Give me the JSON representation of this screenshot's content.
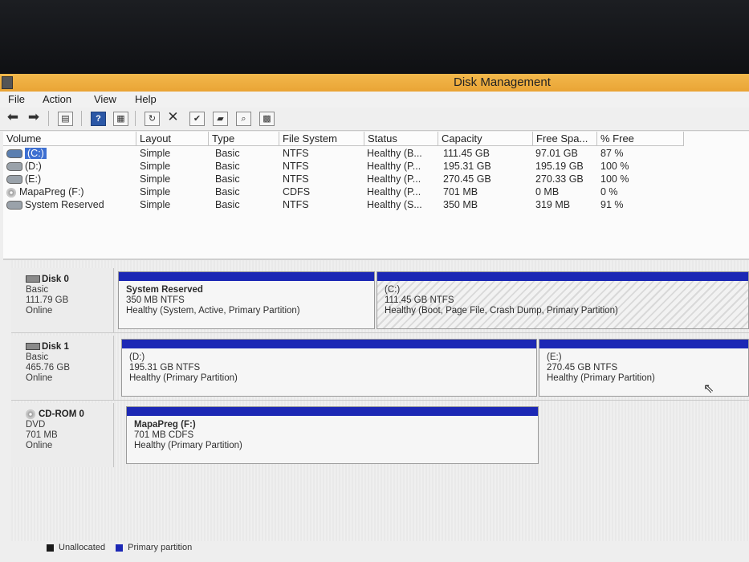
{
  "window": {
    "title": "Disk Management"
  },
  "menu": [
    "File",
    "Action",
    "View",
    "Help"
  ],
  "toolbar": {
    "buttons": [
      "back-arrow-icon",
      "forward-arrow-icon",
      "console-tree-icon",
      "help-icon",
      "properties-icon",
      "refresh-icon",
      "delete-icon",
      "check-icon",
      "open-icon",
      "search-icon",
      "explore-icon"
    ]
  },
  "volume_table": {
    "columns": [
      "Volume",
      "Layout",
      "Type",
      "File System",
      "Status",
      "Capacity",
      "Free Spa...",
      "% Free"
    ],
    "rows": [
      {
        "volume": "(C:)",
        "layout": "Simple",
        "type": "Basic",
        "fs": "NTFS",
        "status": "Healthy (B...",
        "capacity": "111.45 GB",
        "free": "97.01 GB",
        "pct": "87 %"
      },
      {
        "volume": "(D:)",
        "layout": "Simple",
        "type": "Basic",
        "fs": "NTFS",
        "status": "Healthy (P...",
        "capacity": "195.31 GB",
        "free": "195.19 GB",
        "pct": "100 %"
      },
      {
        "volume": "(E:)",
        "layout": "Simple",
        "type": "Basic",
        "fs": "NTFS",
        "status": "Healthy (P...",
        "capacity": "270.45 GB",
        "free": "270.33 GB",
        "pct": "100 %"
      },
      {
        "volume": "MapaPreg (F:)",
        "layout": "Simple",
        "type": "Basic",
        "fs": "CDFS",
        "status": "Healthy (P...",
        "capacity": "701 MB",
        "free": "0 MB",
        "pct": "0 %"
      },
      {
        "volume": "System Reserved",
        "layout": "Simple",
        "type": "Basic",
        "fs": "NTFS",
        "status": "Healthy (S...",
        "capacity": "350 MB",
        "free": "319 MB",
        "pct": "91 %"
      }
    ]
  },
  "disks": [
    {
      "name": "Disk 0",
      "kind": "Basic",
      "size": "111.79 GB",
      "state": "Online",
      "partitions": [
        {
          "name": "System Reserved",
          "size": "350 MB NTFS",
          "status": "Healthy (System, Active, Primary Partition)"
        },
        {
          "name": "(C:)",
          "size": "111.45 GB NTFS",
          "status": "Healthy (Boot, Page File, Crash Dump, Primary Partition)"
        }
      ]
    },
    {
      "name": "Disk 1",
      "kind": "Basic",
      "size": "465.76 GB",
      "state": "Online",
      "partitions": [
        {
          "name": "(D:)",
          "size": "195.31 GB NTFS",
          "status": "Healthy (Primary Partition)"
        },
        {
          "name": "(E:)",
          "size": "270.45 GB NTFS",
          "status": "Healthy (Primary Partition)"
        }
      ]
    },
    {
      "name": "CD-ROM 0",
      "kind": "DVD",
      "size": "701 MB",
      "state": "Online",
      "partitions": [
        {
          "name": "MapaPreg  (F:)",
          "size": "701 MB CDFS",
          "status": "Healthy (Primary Partition)"
        }
      ]
    }
  ],
  "legend": [
    {
      "label": "Unallocated",
      "color": "#1b1b1b"
    },
    {
      "label": "Primary partition",
      "color": "#1c28b5"
    }
  ],
  "colors": {
    "titlebar": "#e9a435",
    "partition_bar": "#1c28b5",
    "selection": "#3d6fd1"
  }
}
